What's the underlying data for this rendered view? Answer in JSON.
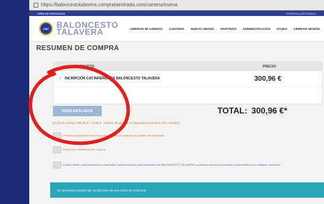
{
  "browser": {
    "url": "https://baloncestotalavera.compralaentrada.com/cantera/nueva"
  },
  "topstrip": {
    "left": "WEB DE ENTRADAS",
    "right": "COMPRALAENTRADA"
  },
  "header": {
    "logo_text": "CBT",
    "brand_line1": "BALONCESTO",
    "brand_line2": "TALAVERA",
    "nav": [
      "LIBERAR MI ASIENTO",
      "CANTERA",
      "NUEVO ABONO",
      "PARTIDOS",
      "ADMINISTRACIÓN",
      "AYUDA",
      "CERRAR SESIÓN"
    ]
  },
  "page_title": "RESUMEN DE COMPRA",
  "table": {
    "col_product": "PRODUCTO",
    "col_price": "PRECIO",
    "rows": [
      {
        "remove": "x",
        "description": "INCRIPCIÓN CAT.INFERIORES BALONCESTO TALAVERA",
        "price": "300,96 €"
      }
    ]
  },
  "total": {
    "label": "TOTAL:",
    "value": "300,96 €*"
  },
  "pay_button": "PAGO EN PLAZOS",
  "note": "El precio incluye 300,00 € + 0,96 € - Gastos de gestión e impuestos incluidos (IVA incluido)",
  "checks": [
    "He leído y acepto los términos y condiciones de compra y la política de privacidad",
    "Acepto las condiciones de compra",
    "Acepto recibir comunicaciones comerciales, publicitarias y/o promocionales del BALONCESTO TALAVERA, pudiendo revocar el presente consentimiento en cualquier momento"
  ],
  "alert": "Es necesario aceptar las condiciones de uso antes de continuar.",
  "colors": {
    "accent": "#2aa6b8",
    "annotation": "#e0201c",
    "brand": "#1f3b9b"
  }
}
